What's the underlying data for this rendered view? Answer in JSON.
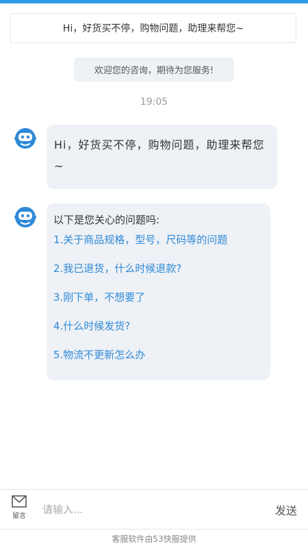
{
  "theme": {
    "accent": "#2f8ad8",
    "bubble_bg": "#eef1f5",
    "top_bar": "#2f9be5"
  },
  "banner": {
    "text": "Hi，好货买不停，购物问题，助理来帮您~"
  },
  "chat": {
    "welcome": "欢迎您的咨询，期待为您服务!",
    "timestamp": "19:05",
    "messages": [
      {
        "sender_icon": "robot-avatar-icon",
        "text": "Hi，好货买不停，购物问题，助理来帮您~"
      },
      {
        "sender_icon": "robot-avatar-icon",
        "title": "以下是您关心的问题吗:",
        "questions": [
          "1.关于商品规格，型号，尺码等的问题",
          "2.我已退货，什么时候退款?",
          "3.刚下单，不想要了",
          "4.什么时候发货?",
          "5.物流不更新怎么办"
        ]
      }
    ]
  },
  "input_bar": {
    "leave_message_icon": "envelope-icon",
    "leave_message_label": "留言",
    "placeholder": "请输入...",
    "send_label": "发送"
  },
  "footer": {
    "text": "客服软件由53快服提供"
  }
}
